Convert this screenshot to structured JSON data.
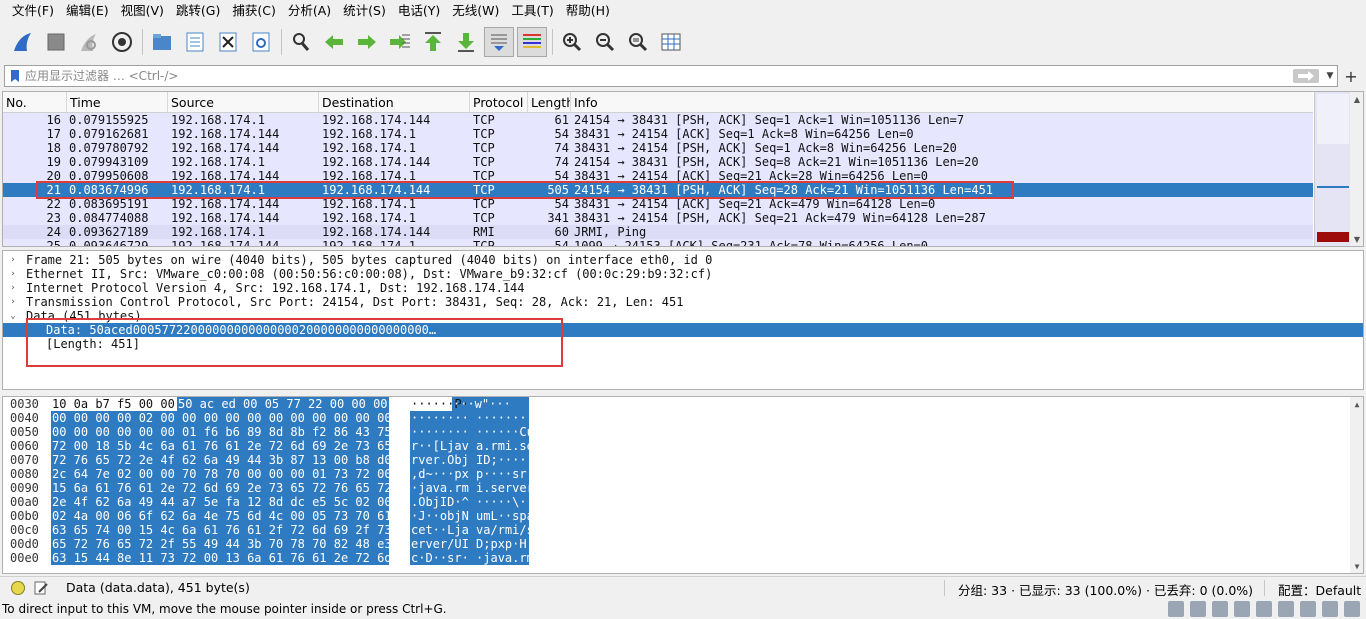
{
  "menu": [
    "文件(F)",
    "编辑(E)",
    "视图(V)",
    "跳转(G)",
    "捕获(C)",
    "分析(A)",
    "统计(S)",
    "电话(Y)",
    "无线(W)",
    "工具(T)",
    "帮助(H)"
  ],
  "filter": {
    "placeholder": "应用显示过滤器 … <Ctrl-/>"
  },
  "columns": {
    "no": "No.",
    "time": "Time",
    "source": "Source",
    "destination": "Destination",
    "protocol": "Protocol",
    "length": "Length",
    "info": "Info"
  },
  "packets": [
    {
      "no": "16",
      "time": "0.079155925",
      "src": "192.168.174.1",
      "dst": "192.168.174.144",
      "proto": "TCP",
      "len": "61",
      "info": "24154 → 38431 [PSH, ACK] Seq=1 Ack=1 Win=1051136 Len=7"
    },
    {
      "no": "17",
      "time": "0.079162681",
      "src": "192.168.174.144",
      "dst": "192.168.174.1",
      "proto": "TCP",
      "len": "54",
      "info": "38431 → 24154 [ACK] Seq=1 Ack=8 Win=64256 Len=0"
    },
    {
      "no": "18",
      "time": "0.079780792",
      "src": "192.168.174.144",
      "dst": "192.168.174.1",
      "proto": "TCP",
      "len": "74",
      "info": "38431 → 24154 [PSH, ACK] Seq=1 Ack=8 Win=64256 Len=20"
    },
    {
      "no": "19",
      "time": "0.079943109",
      "src": "192.168.174.1",
      "dst": "192.168.174.144",
      "proto": "TCP",
      "len": "74",
      "info": "24154 → 38431 [PSH, ACK] Seq=8 Ack=21 Win=1051136 Len=20"
    },
    {
      "no": "20",
      "time": "0.079950608",
      "src": "192.168.174.144",
      "dst": "192.168.174.1",
      "proto": "TCP",
      "len": "54",
      "info": "38431 → 24154 [ACK] Seq=21 Ack=28 Win=64256 Len=0"
    },
    {
      "no": "21",
      "time": "0.083674996",
      "src": "192.168.174.1",
      "dst": "192.168.174.144",
      "proto": "TCP",
      "len": "505",
      "info": "24154 → 38431 [PSH, ACK] Seq=28 Ack=21 Win=1051136 Len=451"
    },
    {
      "no": "22",
      "time": "0.083695191",
      "src": "192.168.174.144",
      "dst": "192.168.174.1",
      "proto": "TCP",
      "len": "54",
      "info": "38431 → 24154 [ACK] Seq=21 Ack=479 Win=64128 Len=0"
    },
    {
      "no": "23",
      "time": "0.084774088",
      "src": "192.168.174.144",
      "dst": "192.168.174.1",
      "proto": "TCP",
      "len": "341",
      "info": "38431 → 24154 [PSH, ACK] Seq=21 Ack=479 Win=64128 Len=287"
    },
    {
      "no": "24",
      "time": "0.093627189",
      "src": "192.168.174.1",
      "dst": "192.168.174.144",
      "proto": "RMI",
      "len": "60",
      "info": "JRMI, Ping"
    },
    {
      "no": "25",
      "time": "0.093646729",
      "src": "192.168.174.144",
      "dst": "192.168.174.1",
      "proto": "TCP",
      "len": "54",
      "info": "1099 → 24153 [ACK] Seq=231 Ack=78 Win=64256 Len=0"
    }
  ],
  "details": [
    {
      "text": "Frame 21: 505 bytes on wire (4040 bits), 505 bytes captured (4040 bits) on interface eth0, id 0",
      "toggle": "›"
    },
    {
      "text": "Ethernet II, Src: VMware_c0:00:08 (00:50:56:c0:00:08), Dst: VMware_b9:32:cf (00:0c:29:b9:32:cf)",
      "toggle": "›"
    },
    {
      "text": "Internet Protocol Version 4, Src: 192.168.174.1, Dst: 192.168.174.144",
      "toggle": "›"
    },
    {
      "text": "Transmission Control Protocol, Src Port: 24154, Dst Port: 38431, Seq: 28, Ack: 21, Len: 451",
      "toggle": "›"
    },
    {
      "text": "Data (451 bytes)",
      "toggle": "⌄"
    },
    {
      "text": "Data: 50aced00057722000000000000000200000000000000000…",
      "toggle": ""
    },
    {
      "text": "[Length: 451]",
      "toggle": ""
    }
  ],
  "hex": [
    {
      "off": "0030",
      "pre": "10 0a b7 f5 00 00 ",
      "bytes": "50 ac  ed 00 05 77 22 00 00 00",
      "apre": "······P·",
      "asc": " ···w\"···"
    },
    {
      "off": "0040",
      "pre": "",
      "bytes": "00 00 00 00 02 00 00 00  00 00 00 00 00 00 00 00",
      "apre": "",
      "asc": "········ ········"
    },
    {
      "off": "0050",
      "pre": "",
      "bytes": "00 00 00 00 00 00 01 f6  b6 89 8d 8b f2 86 43 75",
      "apre": "",
      "asc": "········ ······Cu"
    },
    {
      "off": "0060",
      "pre": "",
      "bytes": "72 00 18 5b 4c 6a 61 76  61 2e 72 6d 69 2e 73 65",
      "apre": "",
      "asc": "r··[Ljav a.rmi.se"
    },
    {
      "off": "0070",
      "pre": "",
      "bytes": "72 76 65 72 2e 4f 62 6a  49 44 3b 87 13 00 b8 d0",
      "apre": "",
      "asc": "rver.Obj ID;·····"
    },
    {
      "off": "0080",
      "pre": "",
      "bytes": "2c 64 7e 02 00 00 70 78  70 00 00 00 01 73 72 00",
      "apre": "",
      "asc": ",d~···px p····sr·"
    },
    {
      "off": "0090",
      "pre": "",
      "bytes": "15 6a 61 76 61 2e 72 6d  69 2e 73 65 72 76 65 72",
      "apre": "",
      "asc": "·java.rm i.server"
    },
    {
      "off": "00a0",
      "pre": "",
      "bytes": "2e 4f 62 6a 49 44 a7 5e  fa 12 8d dc e5 5c 02 00",
      "apre": "",
      "asc": ".ObjID·^ ·····\\··"
    },
    {
      "off": "00b0",
      "pre": "",
      "bytes": "02 4a 00 06 6f 62 6a 4e  75 6d 4c 00 05 73 70 61",
      "apre": "",
      "asc": "·J··objN umL··spa"
    },
    {
      "off": "00c0",
      "pre": "",
      "bytes": "63 65 74 00 15 4c 6a 61  76 61 2f 72 6d 69 2f 73",
      "apre": "",
      "asc": "cet··Lja va/rmi/s"
    },
    {
      "off": "00d0",
      "pre": "",
      "bytes": "65 72 76 65 72 2f 55 49  44 3b 70 78 70 82 48 e3",
      "apre": "",
      "asc": "erver/UI D;pxp·H·"
    },
    {
      "off": "00e0",
      "pre": "",
      "bytes": "63 15 44 8e 11 73 72 00  13 6a 61 76 61 2e 72 6d",
      "apre": "",
      "asc": "c·D··sr· ·java.rm"
    }
  ],
  "status": {
    "field": "Data (data.data), 451 byte(s)",
    "packets": "分组: 33 · 已显示: 33 (100.0%) · 已丢弃: 0 (0.0%)",
    "profile": "配置：Default"
  },
  "vm_message": "To direct input to this VM, move the mouse pointer inside or press Ctrl+G.",
  "colors": {
    "selected": "#2e7bc2",
    "tcp_row": "#e7e6ff",
    "rmi_row": "#dddcf7",
    "highlight_box": "#e03b3b"
  }
}
